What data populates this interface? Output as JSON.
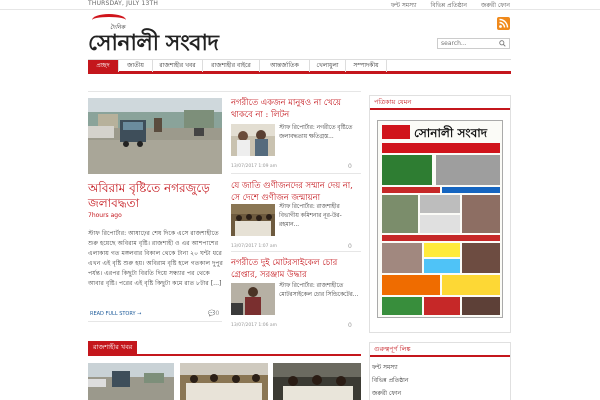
{
  "topbar": {
    "date": "THURSDAY, JULY 13TH",
    "links": [
      "ফন্ট সমস্যা",
      "বিভিন্ন প্রতিষ্ঠান",
      "জরুরী ফোন"
    ]
  },
  "header": {
    "logo_small": "দৈনিক",
    "logo_text": "সোনালী সংবাদ",
    "search_placeholder": "search..."
  },
  "nav": {
    "items": [
      "প্রচ্ছদ",
      "জাতীয়",
      "রাজশাহীর খবর",
      "রাজশাহীর বাইরে",
      "আন্তর্জাতিক",
      "খেলাধুলা",
      "সম্পাদকীয়"
    ],
    "active": "প্রচ্ছদ"
  },
  "lead": {
    "title": "অবিরাম বৃষ্টিতে নগরজুড়ে জলাবদ্ধতা",
    "time": "7hours ago",
    "excerpt": "স্টাফ রিপোর্টার: আষাঢ়ের শেষ দিকে এসে রাজশাহীতে শুরু হয়েছে অবিরাম বৃষ্টি। রাজশাহী ও এর আশপাশের এলাকায় গত মঙ্গলবার বিকাল থেকে টানা ২০ ঘন্টা ধরে এখন এই বৃষ্টি শুরু হয়। অবিরাম বৃষ্টি হলে গতকাল দুপুর পর্যন্ত। এরপর কিছুটা বিরতি দিয়ে সন্ধ্যার পর থেকে আবার বৃষ্টি। পরের এই বৃষ্টি কিছুটা কমে রাত ৮টার [...]",
    "read_more": "READ FULL STORY →",
    "comments": "0"
  },
  "stories": [
    {
      "title": "নগরীতে একজন মানুষও না খেয়ে থাকবে না : লিটন",
      "excerpt": "স্টাফ রিপোর্টার: নগরীতে বৃষ্টিতে জলাবদ্ধতায় ক্ষতিগ্রস্ত...",
      "date": "13/07/2017",
      "time": "1:09 am",
      "comments": "0"
    },
    {
      "title": "যে জাতি গুণীজনদের সম্মান দেয় না, সে দেশে গুণীজন জন্মায়না",
      "excerpt": "স্টাফ রিপোর্টার: রাজশাহীর বিভাগীয় কমিশনার নূর-উর-রহমান...",
      "date": "13/07/2017",
      "time": "1:07 am",
      "comments": "0"
    },
    {
      "title": "নগরীতে দুই মোটরসাইকেল চোর গ্রেপ্তার, সরঞ্জাম উদ্ধার",
      "excerpt": "স্টাফ রিপোর্টার: রাজশাহীতে মোটরসাইকেল চোর সিন্ডিকেটের...",
      "date": "13/07/2017",
      "time": "1:06 am",
      "comments": "0"
    }
  ],
  "sidebar": {
    "paper_title": "পত্রিকায় যেমন",
    "paper_masthead": "সোনালী সংবাদ",
    "links_title": "গুরুত্বপূর্ণ লিঙ্ক",
    "links": [
      "ফন্ট সমস্যা",
      "বিভিন্ন প্রতিষ্ঠান",
      "জরুরী ফোন"
    ]
  },
  "section": {
    "title": "রাজশাহীর খবর"
  },
  "colors": {
    "accent": "#c4161c",
    "link": "#1d5b9a"
  }
}
